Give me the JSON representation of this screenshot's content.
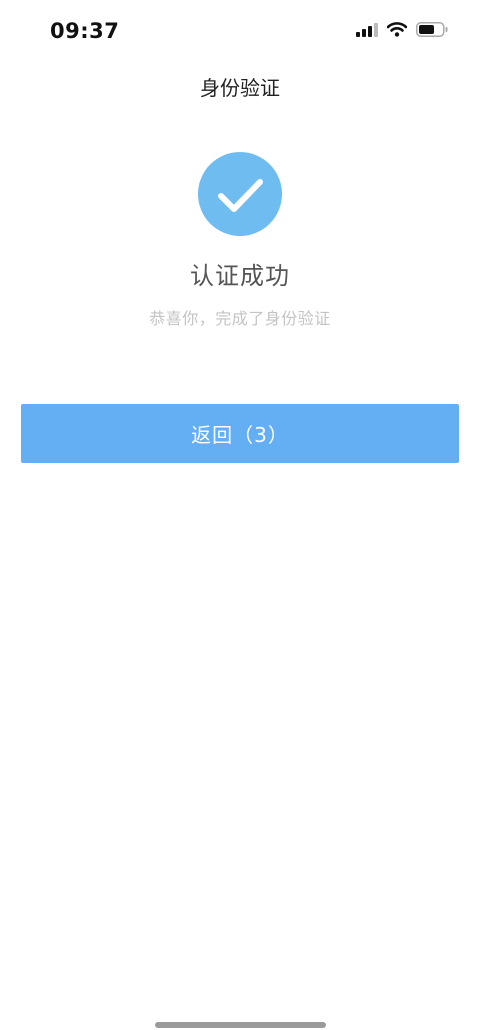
{
  "status_bar": {
    "time": "09:37"
  },
  "header": {
    "title": "身份验证"
  },
  "result": {
    "icon": "checkmark-icon",
    "title": "认证成功",
    "subtitle": "恭喜你，完成了身份验证"
  },
  "actions": {
    "back_label": "返回（3）"
  },
  "colors": {
    "success_icon": "#6fbcf0",
    "button": "#64aef4",
    "subtitle_text": "#c4c4c4"
  }
}
